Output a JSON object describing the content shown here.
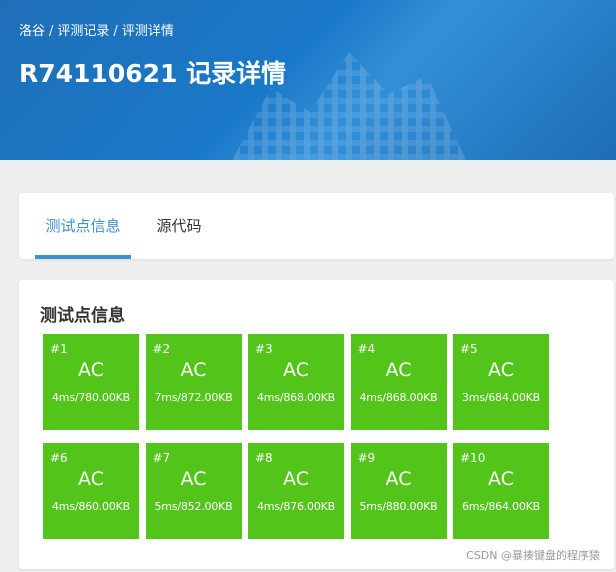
{
  "header": {
    "breadcrumb": [
      "洛谷",
      "评测记录",
      "评测详情"
    ],
    "breadcrumb_sep": "/",
    "title": "R74110621 记录详情"
  },
  "tabs": [
    {
      "label": "测试点信息",
      "active": true
    },
    {
      "label": "源代码",
      "active": false
    }
  ],
  "cases_panel": {
    "title": "测试点信息",
    "cases": [
      {
        "num": "#1",
        "status": "AC",
        "stats": "4ms/780.00KB"
      },
      {
        "num": "#2",
        "status": "AC",
        "stats": "7ms/872.00KB"
      },
      {
        "num": "#3",
        "status": "AC",
        "stats": "4ms/868.00KB"
      },
      {
        "num": "#4",
        "status": "AC",
        "stats": "4ms/868.00KB"
      },
      {
        "num": "#5",
        "status": "AC",
        "stats": "3ms/684.00KB"
      },
      {
        "num": "#6",
        "status": "AC",
        "stats": "4ms/860.00KB"
      },
      {
        "num": "#7",
        "status": "AC",
        "stats": "5ms/852.00KB"
      },
      {
        "num": "#8",
        "status": "AC",
        "stats": "4ms/876.00KB"
      },
      {
        "num": "#9",
        "status": "AC",
        "stats": "5ms/880.00KB"
      },
      {
        "num": "#10",
        "status": "AC",
        "stats": "6ms/864.00KB"
      }
    ]
  },
  "colors": {
    "accent": "#3e90d0",
    "ac_green": "#52c41a",
    "header_blue": "#1a78c8"
  },
  "watermark": "CSDN @暴揍键盘的程序猿"
}
